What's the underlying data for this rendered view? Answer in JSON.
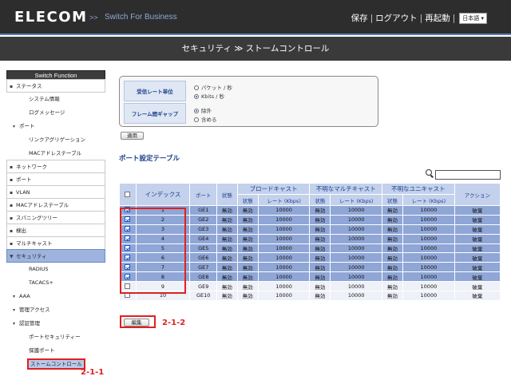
{
  "header": {
    "logo": "ELECOM",
    "brand_sep": ">>",
    "brand_sub": "Switch For Business",
    "links": [
      "保存",
      "ログアウト",
      "再起動"
    ],
    "language": "日本語",
    "page_title": "セキュリティ ≫ ストームコントロール",
    "colors": {
      "accent": "#5b7db8",
      "header_bg": "#2d2d2d"
    }
  },
  "sidebar": {
    "title": "Switch Function",
    "items": [
      {
        "label": "ステータス",
        "level": 0,
        "expanded": true
      },
      {
        "label": "システム情報",
        "level": 1
      },
      {
        "label": "ログメッセージ",
        "level": 1
      },
      {
        "label": "ポート",
        "level": 1,
        "expanded": true
      },
      {
        "label": "リンクアグリゲーション",
        "level": 2
      },
      {
        "label": "MACアドレステーブル",
        "level": 2
      },
      {
        "label": "ネットワーク",
        "level": 0
      },
      {
        "label": "ポート",
        "level": 0
      },
      {
        "label": "VLAN",
        "level": 0
      },
      {
        "label": "MACアドレステーブル",
        "level": 0
      },
      {
        "label": "スパニングツリー",
        "level": 0
      },
      {
        "label": "検出",
        "level": 0
      },
      {
        "label": "マルチキャスト",
        "level": 0
      },
      {
        "label": "セキュリティ",
        "level": 0,
        "selected": true
      },
      {
        "label": "RADIUS",
        "level": 1
      },
      {
        "label": "TACACS+",
        "level": 1
      },
      {
        "label": "AAA",
        "level": 1
      },
      {
        "label": "管理アクセス",
        "level": 1
      },
      {
        "label": "認証管理",
        "level": 1,
        "expanded": true
      },
      {
        "label": "ポートセキュリティー",
        "level": 2
      },
      {
        "label": "保護ポート",
        "level": 2
      },
      {
        "label": "ストームコントロール",
        "level": 2,
        "current": true
      }
    ]
  },
  "settings": {
    "rate_unit_label": "受信レート単位",
    "rate_unit_options": [
      "パケット / 秒",
      "Kbits / 秒"
    ],
    "rate_unit_selected": "Kbits / 秒",
    "frame_gap_label": "フレーム間ギャップ",
    "frame_gap_options": [
      "除外",
      "含める"
    ],
    "frame_gap_selected": "除外",
    "apply_button": "適用"
  },
  "port_table": {
    "title": "ポート設定テーブル",
    "search_placeholder": "",
    "headers": {
      "index": "インデックス",
      "port": "ポート",
      "state": "状態",
      "broadcast": "ブロードキャスト",
      "unknown_multicast": "不明なマルチキャスト",
      "unknown_unicast": "不明なユニキャスト",
      "action": "アクション",
      "sub_state": "状態",
      "sub_rate": "レート (Kbps)"
    },
    "rows": [
      {
        "checked": true,
        "index": "1",
        "port": "GE1",
        "state": "無効",
        "b_state": "無効",
        "b_rate": "10000",
        "m_state": "無効",
        "m_rate": "10000",
        "u_state": "無効",
        "u_rate": "10000",
        "action": "破棄"
      },
      {
        "checked": true,
        "index": "2",
        "port": "GE2",
        "state": "無効",
        "b_state": "無効",
        "b_rate": "10000",
        "m_state": "無効",
        "m_rate": "10000",
        "u_state": "無効",
        "u_rate": "10000",
        "action": "破棄"
      },
      {
        "checked": true,
        "index": "3",
        "port": "GE3",
        "state": "無効",
        "b_state": "無効",
        "b_rate": "10000",
        "m_state": "無効",
        "m_rate": "10000",
        "u_state": "無効",
        "u_rate": "10000",
        "action": "破棄"
      },
      {
        "checked": true,
        "index": "4",
        "port": "GE4",
        "state": "無効",
        "b_state": "無効",
        "b_rate": "10000",
        "m_state": "無効",
        "m_rate": "10000",
        "u_state": "無効",
        "u_rate": "10000",
        "action": "破棄"
      },
      {
        "checked": true,
        "index": "5",
        "port": "GE5",
        "state": "無効",
        "b_state": "無効",
        "b_rate": "10000",
        "m_state": "無効",
        "m_rate": "10000",
        "u_state": "無効",
        "u_rate": "10000",
        "action": "破棄"
      },
      {
        "checked": true,
        "index": "6",
        "port": "GE6",
        "state": "無効",
        "b_state": "無効",
        "b_rate": "10000",
        "m_state": "無効",
        "m_rate": "10000",
        "u_state": "無効",
        "u_rate": "10000",
        "action": "破棄"
      },
      {
        "checked": true,
        "index": "7",
        "port": "GE7",
        "state": "無効",
        "b_state": "無効",
        "b_rate": "10000",
        "m_state": "無効",
        "m_rate": "10000",
        "u_state": "無効",
        "u_rate": "10000",
        "action": "破棄"
      },
      {
        "checked": true,
        "index": "8",
        "port": "GE8",
        "state": "無効",
        "b_state": "無効",
        "b_rate": "10000",
        "m_state": "無効",
        "m_rate": "10000",
        "u_state": "無効",
        "u_rate": "10000",
        "action": "破棄"
      },
      {
        "checked": false,
        "index": "9",
        "port": "GE9",
        "state": "無効",
        "b_state": "無効",
        "b_rate": "10000",
        "m_state": "無効",
        "m_rate": "10000",
        "u_state": "無効",
        "u_rate": "10000",
        "action": "破棄"
      },
      {
        "checked": false,
        "index": "10",
        "port": "GE10",
        "state": "無効",
        "b_state": "無効",
        "b_rate": "10000",
        "m_state": "無効",
        "m_rate": "10000",
        "u_state": "無効",
        "u_rate": "10000",
        "action": "破棄"
      }
    ],
    "edit_button": "編集"
  },
  "annotations": {
    "sidebar_callout": "2-1-1",
    "edit_callout": "2-1-2"
  }
}
